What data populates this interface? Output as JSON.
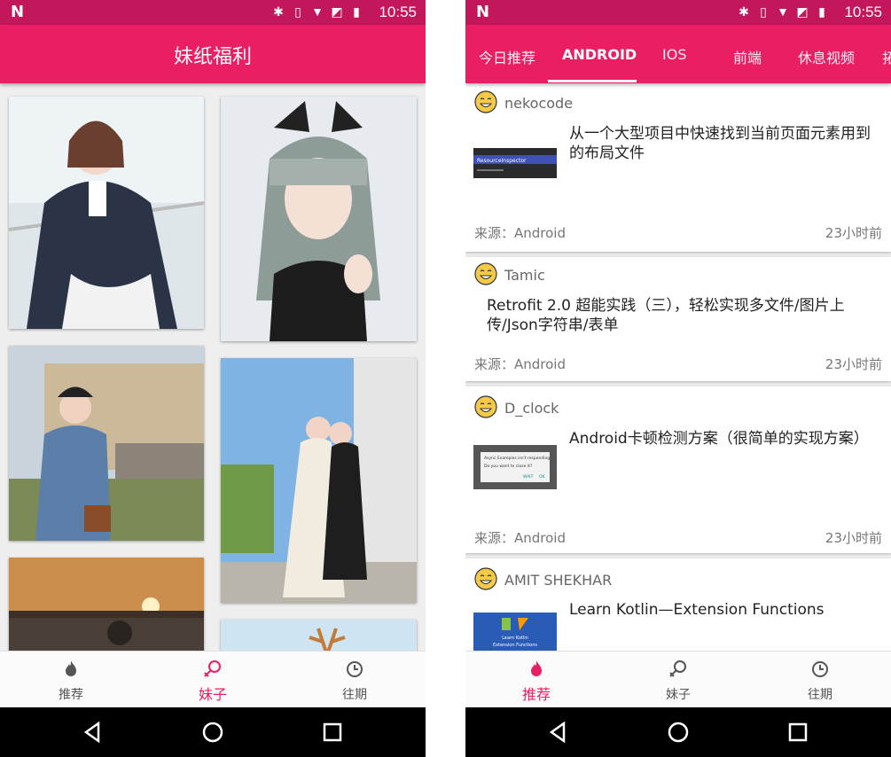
{
  "status_bar": {
    "time": "10:55",
    "logo": "N"
  },
  "left_screen": {
    "title": "妹纸福利",
    "bottom_nav": [
      {
        "label": "推荐",
        "icon": "flame-icon",
        "active": false
      },
      {
        "label": "妹子",
        "icon": "female-icon",
        "active": true
      },
      {
        "label": "往期",
        "icon": "clock-icon",
        "active": false
      }
    ]
  },
  "right_screen": {
    "tabs": [
      {
        "label": "今日推荐",
        "active": false
      },
      {
        "label": "ANDROID",
        "active": true
      },
      {
        "label": "IOS",
        "active": false
      },
      {
        "label": "前端",
        "active": false
      },
      {
        "label": "休息视频",
        "active": false
      },
      {
        "label": "拓",
        "active": false
      }
    ],
    "cards": [
      {
        "author": "nekocode",
        "title": "从一个大型项目中快速找到当前页面元素用到的布局文件",
        "source": "来源：Android",
        "time": "23小时前",
        "has_thumb": true
      },
      {
        "author": "Tamic",
        "title": "Retrofit 2.0 超能实践（三），轻松实现多文件/图片上传/Json字符串/表单",
        "source": "来源：Android",
        "time": "23小时前",
        "has_thumb": false
      },
      {
        "author": "D_clock",
        "title": "Android卡顿检测方案（很简单的实现方案）",
        "source": "来源：Android",
        "time": "23小时前",
        "has_thumb": true
      },
      {
        "author": "AMIT SHEKHAR",
        "title": "Learn Kotlin—Extension Functions",
        "source": "",
        "time": "",
        "has_thumb": true
      }
    ],
    "thumb_text": {
      "resource_inspector": "ResourceInspector",
      "dialog_title": "Async Examples isn't responding.",
      "dialog_question": "Do you want to close it?",
      "dialog_wait": "WAIT",
      "dialog_ok": "OK",
      "kotlin_line1": "Learn Kotlin",
      "kotlin_line2": "Extension Functions"
    },
    "bottom_nav": [
      {
        "label": "推荐",
        "icon": "flame-icon",
        "active": true
      },
      {
        "label": "妹子",
        "icon": "female-icon",
        "active": false
      },
      {
        "label": "往期",
        "icon": "clock-icon",
        "active": false
      }
    ]
  },
  "colors": {
    "primary": "#e91e63",
    "primary_dark": "#c2185b",
    "accent": "#e91e63"
  }
}
